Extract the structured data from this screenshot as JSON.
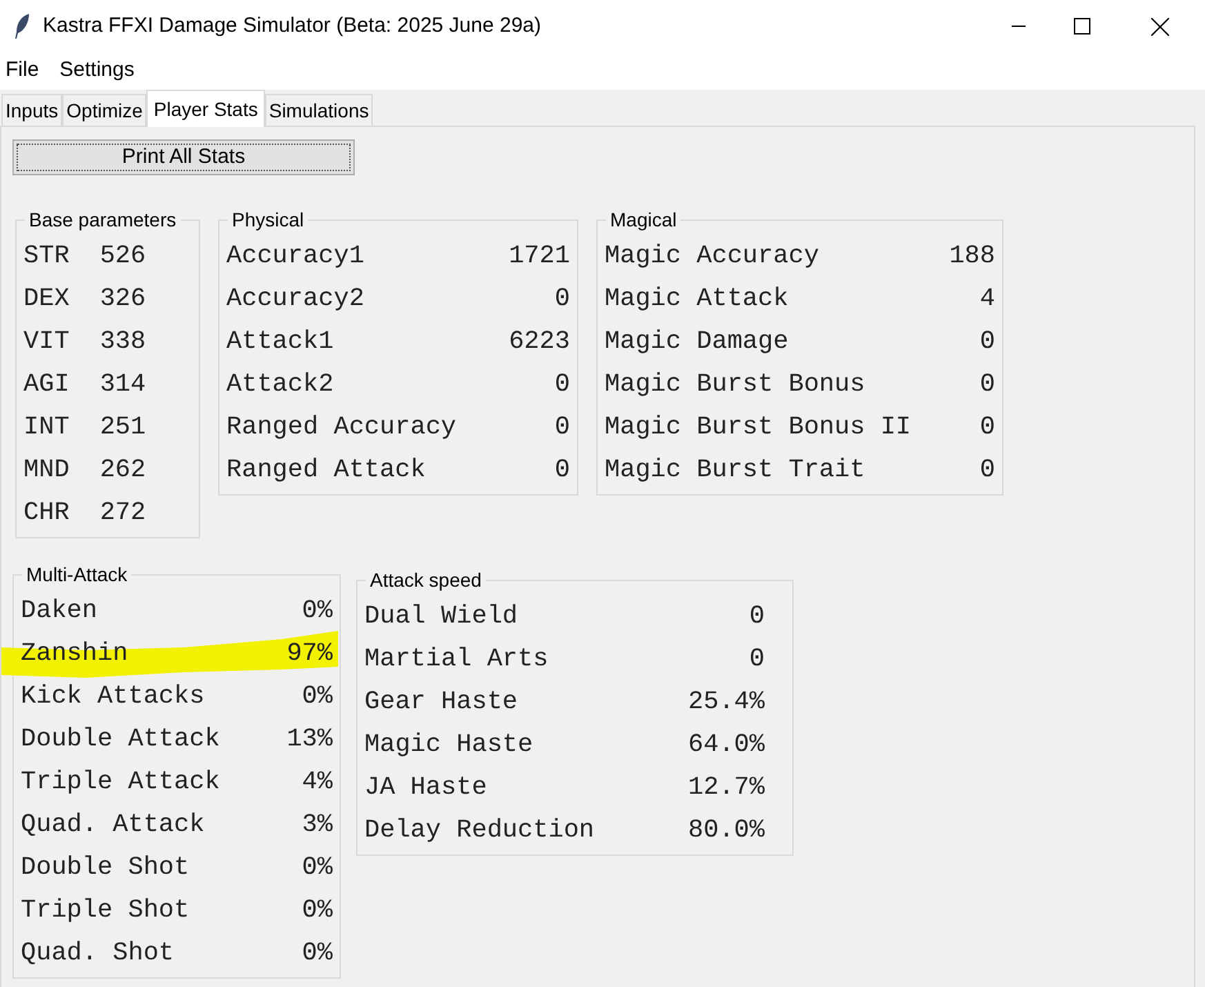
{
  "window": {
    "title": "Kastra FFXI Damage Simulator (Beta: 2025 June 29a)"
  },
  "menu": [
    "File",
    "Settings"
  ],
  "tabs": [
    {
      "label": "Inputs",
      "selected": false
    },
    {
      "label": "Optimize",
      "selected": false
    },
    {
      "label": "Player Stats",
      "selected": true
    },
    {
      "label": "Simulations",
      "selected": false
    }
  ],
  "print_button": "Print All Stats",
  "groups_top": [
    {
      "title": "Base parameters",
      "compact": true,
      "rows": [
        {
          "label": "STR",
          "value": "526"
        },
        {
          "label": "DEX",
          "value": "326"
        },
        {
          "label": "VIT",
          "value": "338"
        },
        {
          "label": "AGI",
          "value": "314"
        },
        {
          "label": "INT",
          "value": "251"
        },
        {
          "label": "MND",
          "value": "262"
        },
        {
          "label": "CHR",
          "value": "272"
        }
      ]
    },
    {
      "title": "Physical",
      "compact": false,
      "rows": [
        {
          "label": "Accuracy1",
          "value": "1721"
        },
        {
          "label": "Accuracy2",
          "value": "0"
        },
        {
          "label": "Attack1",
          "value": "6223"
        },
        {
          "label": "Attack2",
          "value": "0"
        },
        {
          "label": "Ranged Accuracy",
          "value": "0"
        },
        {
          "label": "Ranged Attack",
          "value": "0"
        }
      ]
    },
    {
      "title": "Magical",
      "compact": false,
      "rows": [
        {
          "label": "Magic Accuracy",
          "value": "188"
        },
        {
          "label": "Magic Attack",
          "value": "4"
        },
        {
          "label": "Magic Damage",
          "value": "0"
        },
        {
          "label": "Magic Burst Bonus",
          "value": "0"
        },
        {
          "label": "Magic Burst Bonus II",
          "value": "0"
        },
        {
          "label": "Magic Burst Trait",
          "value": "0"
        }
      ]
    }
  ],
  "groups_bottom": [
    {
      "title": "Multi-Attack",
      "rows": [
        {
          "label": "Daken",
          "value": "0%",
          "highlighted": false
        },
        {
          "label": "Zanshin",
          "value": "97%",
          "highlighted": true
        },
        {
          "label": "Kick Attacks",
          "value": "0%",
          "highlighted": false
        },
        {
          "label": "Double Attack",
          "value": "13%",
          "highlighted": false
        },
        {
          "label": "Triple Attack",
          "value": "4%",
          "highlighted": false
        },
        {
          "label": "Quad. Attack",
          "value": "3%",
          "highlighted": false
        },
        {
          "label": "Double Shot",
          "value": "0%",
          "highlighted": false
        },
        {
          "label": "Triple Shot",
          "value": "0%",
          "highlighted": false
        },
        {
          "label": "Quad. Shot",
          "value": "0%",
          "highlighted": false
        }
      ]
    },
    {
      "title": "Attack speed",
      "rows": [
        {
          "label": "Dual Wield",
          "value": "0",
          "highlighted": false
        },
        {
          "label": "Martial Arts",
          "value": "0",
          "highlighted": false
        },
        {
          "label": "Gear Haste",
          "value": "25.4%",
          "highlighted": false
        },
        {
          "label": "Magic Haste",
          "value": "64.0%",
          "highlighted": false
        },
        {
          "label": "JA Haste",
          "value": "12.7%",
          "highlighted": false
        },
        {
          "label": "Delay Reduction",
          "value": "80.0%",
          "highlighted": false
        }
      ]
    }
  ]
}
